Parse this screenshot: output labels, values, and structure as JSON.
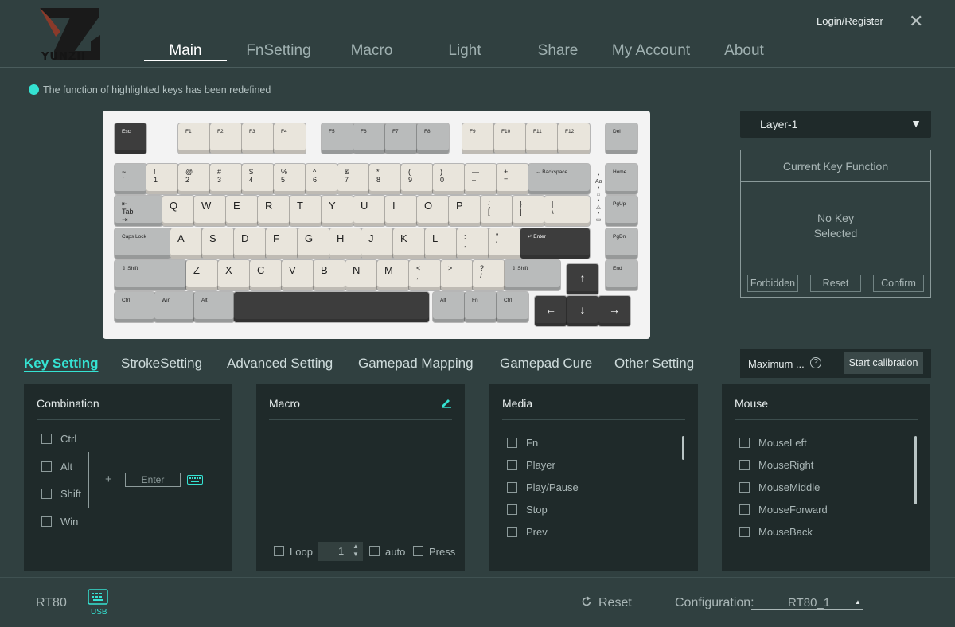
{
  "brand": "YUNZII",
  "header": {
    "login": "Login/Register",
    "close": "✕"
  },
  "nav": [
    "Main",
    "FnSetting",
    "Macro",
    "Light",
    "Share",
    "My Account",
    "About"
  ],
  "hint": "The function of highlighted keys has been redefined",
  "keyboard": {
    "esc": "Esc",
    "del": "Del",
    "home": "Home",
    "pgup": "PgUp",
    "pgdn": "PgDn",
    "end": "End",
    "fkeys": [
      "F1",
      "F2",
      "F3",
      "F4",
      "F5",
      "F6",
      "F7",
      "F8",
      "F9",
      "F10",
      "F11",
      "F12"
    ],
    "numrow": [
      "~\n`",
      "!\n1",
      "@\n2",
      "#\n3",
      "$\n4",
      "%\n5",
      "^\n6",
      "&\n7",
      "*\n8",
      "(\n9",
      ")\n0",
      "—\n–",
      "+\n="
    ],
    "backspace": "← Backspace",
    "tab": "⇤\nTab\n⇥",
    "qrow": [
      "Q",
      "W",
      "E",
      "R",
      "T",
      "Y",
      "U",
      "I",
      "O",
      "P",
      "{\n[",
      "}\n]",
      "|\n\\"
    ],
    "caps": "Caps Lock",
    "arow": [
      "A",
      "S",
      "D",
      "F",
      "G",
      "H",
      "J",
      "K",
      "L",
      ":\n;",
      "\"\n'"
    ],
    "enter": "↵ Enter",
    "lshift": "⇧ Shift",
    "zrow": [
      "Z",
      "X",
      "C",
      "V",
      "B",
      "N",
      "M",
      "<\n,",
      ">\n.",
      "?\n/"
    ],
    "rshift": "⇧ Shift",
    "ctrl": "Ctrl",
    "win": "Win",
    "alt": "Alt",
    "ralt": "Alt",
    "fn": "Fn",
    "rctrl": "Ctrl",
    "up": "↑",
    "left": "←",
    "down": "↓",
    "right": "→"
  },
  "layer": {
    "value": "Layer-1",
    "arrow": "▼"
  },
  "current_key": {
    "title": "Current Key Function",
    "empty": "No Key\nSelected",
    "forbidden": "Forbidden",
    "reset": "Reset",
    "confirm": "Confirm"
  },
  "subtabs": [
    "Key Setting",
    "StrokeSetting",
    "Advanced Setting",
    "Gamepad Mapping",
    "Gamepad Cure",
    "Other Setting"
  ],
  "calibration": {
    "label": "Maximum ...",
    "help": "?",
    "button": "Start calibration"
  },
  "combination": {
    "title": "Combination",
    "mods": [
      "Ctrl",
      "Alt",
      "Shift",
      "Win"
    ],
    "plus": "+",
    "placeholder": "Enter"
  },
  "macro": {
    "title": "Macro",
    "loop": "Loop",
    "loop_value": "1",
    "auto": "auto",
    "press": "Press"
  },
  "media": {
    "title": "Media",
    "items": [
      "Fn",
      "Player",
      "Play/Pause",
      "Stop",
      "Prev"
    ]
  },
  "mouse": {
    "title": "Mouse",
    "items": [
      "MouseLeft",
      "MouseRight",
      "MouseMiddle",
      "MouseForward",
      "MouseBack"
    ]
  },
  "footer": {
    "device": "RT80",
    "usb": "USB",
    "reset": "Reset",
    "config_label": "Configuration:",
    "config_value": "RT80_1"
  },
  "colors": {
    "accent": "#35e3d3",
    "bg": "#304040",
    "panel": "#1f2a2a"
  }
}
